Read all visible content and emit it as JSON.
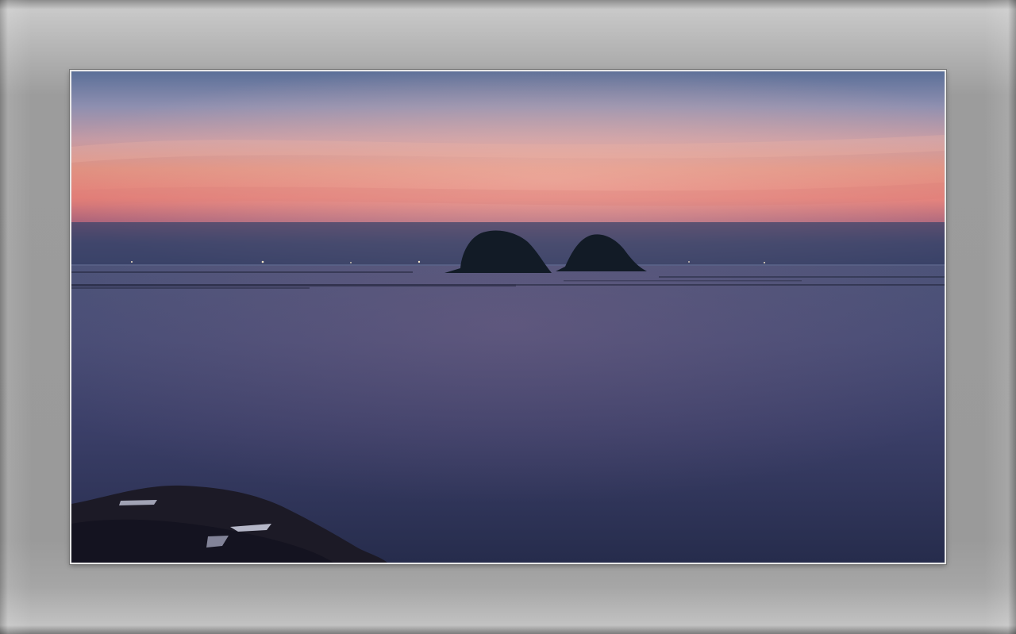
{
  "scene": {
    "subject": "twin-islands-at-dusk",
    "colors": {
      "frame": "#9a9a9a",
      "mat_border": "#e8e8e8",
      "sky_top": "#5a6f96",
      "sky_glow": "#e98f7c",
      "horizon_haze": "#3b4468",
      "sea": "#2f3557",
      "island": "#101a24"
    }
  }
}
